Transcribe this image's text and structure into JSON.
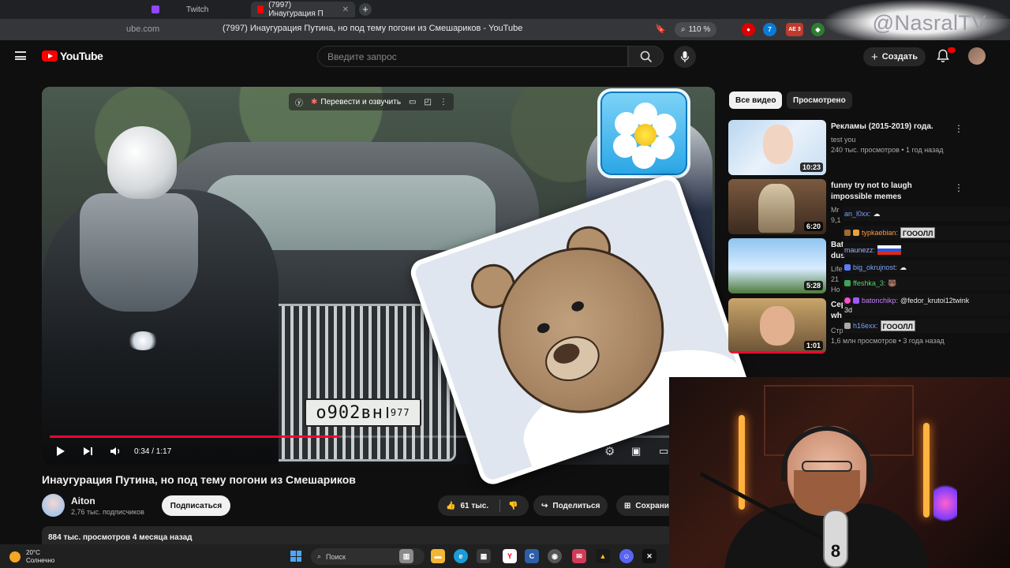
{
  "browser": {
    "tabs": [
      {
        "label": "Twitch"
      },
      {
        "label": "(7997) Инаугурация П"
      }
    ],
    "url_host": "ube.com",
    "url_title": "(7997) Инаугурация Путина, но под тему погони из Смешариков - YouTube",
    "zoom": "110 %",
    "ext_badges": [
      "AE 3"
    ]
  },
  "watermark": "@NasralTV",
  "header": {
    "logo": "YouTube",
    "search_placeholder": "Введите запрос",
    "create_label": "Создать"
  },
  "player": {
    "translate_label": "Перевести и озвучить",
    "time": "0:34 / 1:17",
    "progress": 0.44,
    "plate": "о902вн"
  },
  "video": {
    "title": "Инаугурация Путина, но под тему погони из Смешариков",
    "channel": "Aiton",
    "subs": "2,76 тыс. подписчиков",
    "subscribe": "Подписаться",
    "likes": "61 тыс.",
    "share": "Поделиться",
    "save": "Сохрани",
    "views_date": "884 тыс. просмотров  4 месяца назад"
  },
  "sidebar": {
    "chips": [
      "Все видео",
      "Просмотрено"
    ],
    "recs": [
      {
        "title": "Рекламы (2015-2019) года.",
        "channel": "test you",
        "meta": "240 тыс. просмотров • 1 год назад",
        "dur": "10:23"
      },
      {
        "title": "funny try not to laugh impossible memes",
        "channel": "Mr",
        "meta": "9,1",
        "dur": "6:20"
      },
      {
        "title": "Bat dus",
        "channel": "Life",
        "meta": "21",
        "extra": "Ho",
        "dur": "5:28"
      },
      {
        "title": "Cep wh",
        "channel": "Стр",
        "meta": "1,6 млн просмотров • 3 года назад",
        "dur": "1:01"
      }
    ]
  },
  "chat": [
    {
      "user": "an_l0xx:",
      "color": "#7aa3ff",
      "text": "",
      "emote": ""
    },
    {
      "user": "typkaebian:",
      "color": "#ff9a3c",
      "text": "",
      "emote": "ГОООЛЛ"
    },
    {
      "user": "maunezz:",
      "color": "#9db4ff",
      "text": "",
      "emote": ""
    },
    {
      "user": "big_okrujnost:",
      "color": "#7aa3ff",
      "text": "",
      "emote": ""
    },
    {
      "user": "ffeshka_3:",
      "color": "#57d36b",
      "text": "",
      "emote": ""
    },
    {
      "user": "batonchikp:",
      "color": "#c77dff",
      "text": "@fedor_krutoi12twink",
      "emote": ""
    },
    {
      "user": "",
      "color": "#e8e8e8",
      "text": "3d",
      "emote": ""
    },
    {
      "user": "h16exx:",
      "color": "#7aa3ff",
      "text": "",
      "emote": "ГОООЛЛ"
    }
  ],
  "taskbar": {
    "temp": "20°C",
    "weather": "Солнечно",
    "search": "Поиск"
  }
}
